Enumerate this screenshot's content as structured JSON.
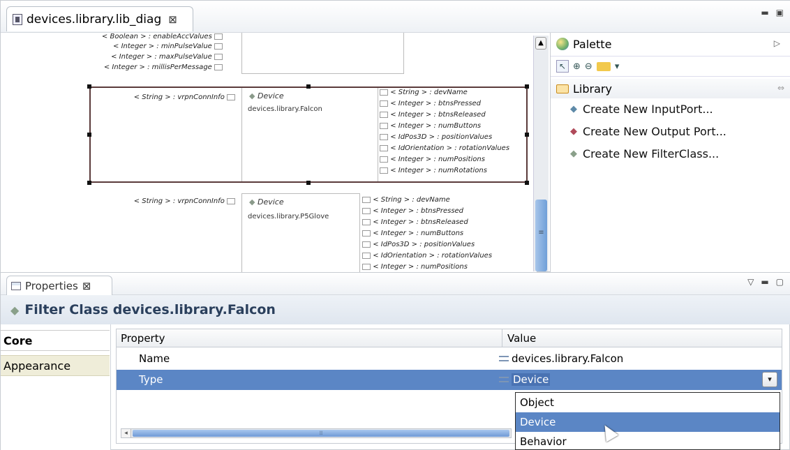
{
  "editor": {
    "tab_title": "devices.library.lib_diag",
    "tab_close": "⊠"
  },
  "diagram": {
    "top_labels": [
      "< Boolean > : enableAccValues",
      "< Integer > : minPulseValue",
      "< Integer > : maxPulseValue",
      "< Integer > : millisPerMessage"
    ],
    "falcon": {
      "input": "< String > : vrpnConnInfo",
      "title": "Device",
      "name": "devices.library.Falcon",
      "outputs": [
        "< String > : devName",
        "< Integer > : btnsPressed",
        "< Integer > : btnsReleased",
        "< Integer > : numButtons",
        "< IdPos3D > : positionValues",
        "< IdOrientation > : rotationValues",
        "< Integer > : numPositions",
        "< Integer > : numRotations"
      ]
    },
    "glove": {
      "input": "< String > : vrpnConnInfo",
      "title": "Device",
      "name": "devices.library.P5Glove",
      "outputs": [
        "< String > : devName",
        "< Integer > : btnsPressed",
        "< Integer > : btnsReleased",
        "< Integer > : numButtons",
        "< IdPos3D > : positionValues",
        "< IdOrientation > : rotationValues",
        "< Integer > : numPositions"
      ]
    }
  },
  "palette": {
    "title": "Palette",
    "drawer": "Library",
    "items": [
      {
        "label": "Create New InputPort...",
        "icon": "input-port-icon",
        "color": "#5e8aa8"
      },
      {
        "label": "Create New Output Port...",
        "icon": "output-port-icon",
        "color": "#b04a5a"
      },
      {
        "label": "Create New FilterClass...",
        "icon": "filter-class-icon",
        "color": "#8aa08a"
      }
    ]
  },
  "properties": {
    "tab_title": "Properties",
    "tab_close": "⊠",
    "heading": "Filter Class devices.library.Falcon",
    "side_tabs": [
      "Core",
      "Appearance"
    ],
    "columns": {
      "property": "Property",
      "value": "Value"
    },
    "rows": [
      {
        "name": "Name",
        "value": "devices.library.Falcon"
      },
      {
        "name": "Type",
        "value": "Device"
      }
    ],
    "type_options": [
      "Object",
      "Device",
      "Behavior"
    ],
    "selected_option": "Device"
  },
  "colors": {
    "selection": "#5b86c5",
    "title_text": "#2a3f5c"
  }
}
